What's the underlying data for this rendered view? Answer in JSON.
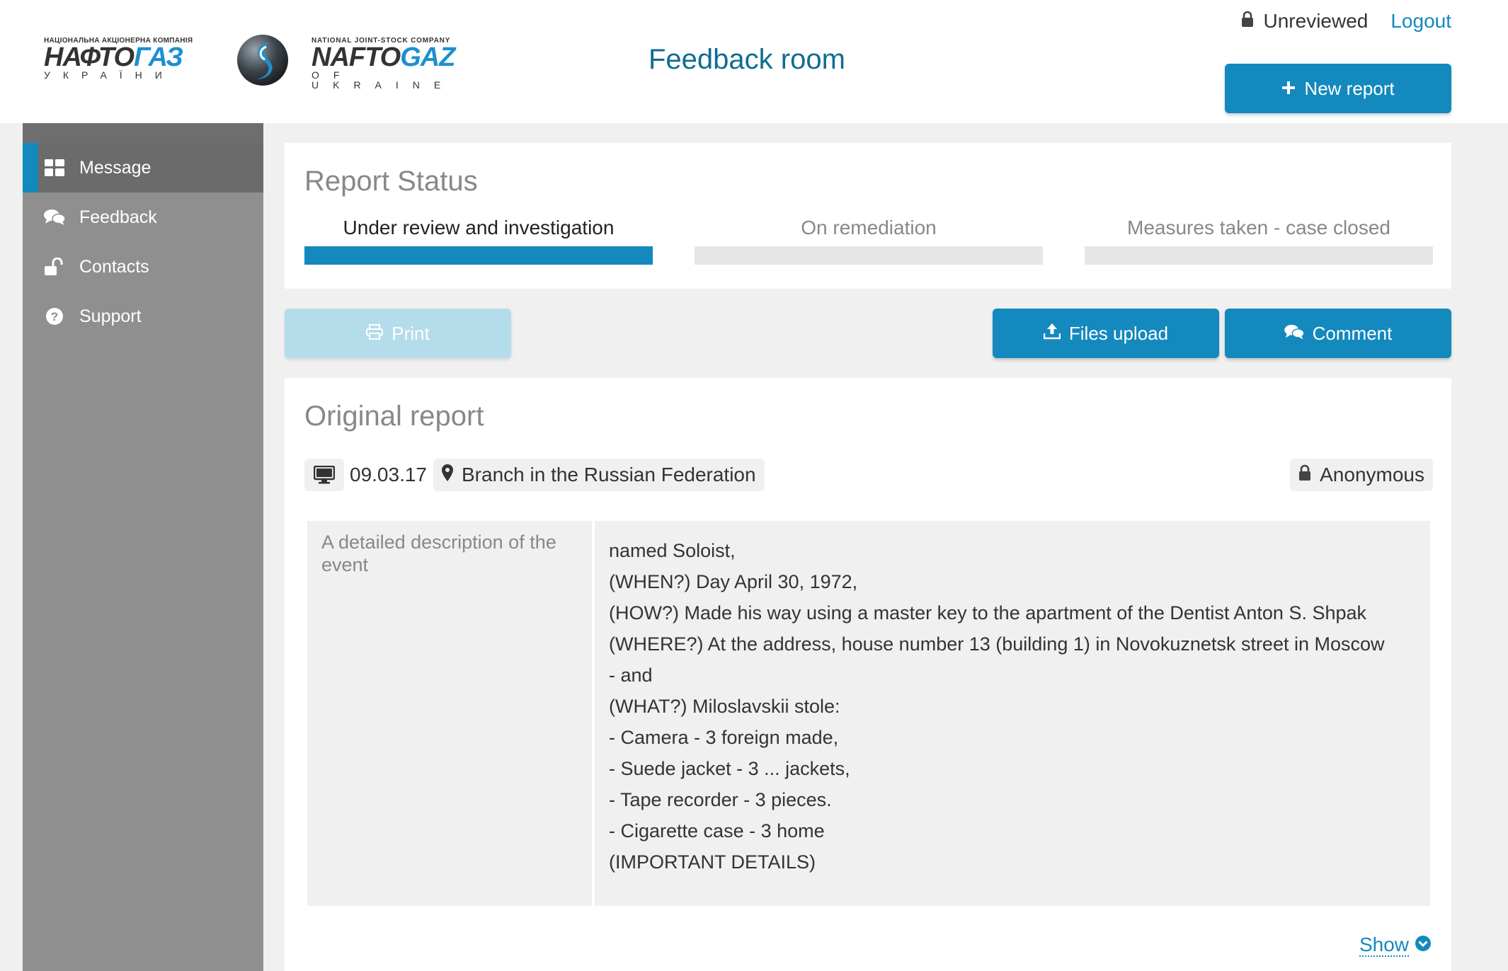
{
  "header": {
    "logo_left": {
      "top_text": "НАЦІОНАЛЬНА АКЦІОНЕРНА КОМПАНІЯ",
      "brand_dark": "НАФТО",
      "brand_blue": "ГАЗ",
      "bottom_text": "УКРАЇНИ"
    },
    "logo_right": {
      "top_text": "NATIONAL JOINT-STOCK COMPANY",
      "brand_dark": "NAFTO",
      "brand_blue": "GAZ",
      "bottom_text": "OF UKRAINE"
    },
    "title": "Feedback room",
    "status": "Unreviewed",
    "logout": "Logout",
    "new_report": "New report"
  },
  "sidebar": {
    "items": [
      {
        "label": "Message",
        "icon": "grid-icon",
        "active": true
      },
      {
        "label": "Feedback",
        "icon": "chat-bubbles-icon",
        "active": false
      },
      {
        "label": "Contacts",
        "icon": "unlock-icon",
        "active": false
      },
      {
        "label": "Support",
        "icon": "question-circle-icon",
        "active": false
      }
    ]
  },
  "report_status": {
    "title": "Report Status",
    "steps": [
      {
        "label": "Under review and investigation",
        "active": true
      },
      {
        "label": "On remediation",
        "active": false
      },
      {
        "label": "Measures taken - case closed",
        "active": false
      }
    ]
  },
  "actions": {
    "print": "Print",
    "files_upload": "Files upload",
    "comment": "Comment"
  },
  "original_report": {
    "title": "Original report",
    "date": "09.03.17",
    "branch": "Branch in the Russian Federation",
    "anonymity": "Anonymous",
    "description_label": "A detailed description of the event",
    "description_lines": [
      "named Soloist,",
      "(WHEN?) Day April 30, 1972,",
      "(HOW?) Made his way using a master key to the apartment of the Dentist Anton S. Shpak",
      "(WHERE?) At the address, house number 13 (building 1) in Novokuznetsk street in Moscow",
      "- and",
      "(WHAT?) Miloslavskii stole:",
      "- Camera - 3 foreign made,",
      "- Suede jacket - 3 ... jackets,",
      "- Tape recorder - 3 pieces.",
      "- Cigarette case - 3 home",
      "(IMPORTANT DETAILS)"
    ],
    "show": "Show"
  },
  "colors": {
    "accent": "#1489bd",
    "title_teal": "#0f6d91",
    "sidebar_bg": "#8f8f8f",
    "sidebar_active": "#6b6b6b",
    "print_disabled": "#b5dcea"
  }
}
